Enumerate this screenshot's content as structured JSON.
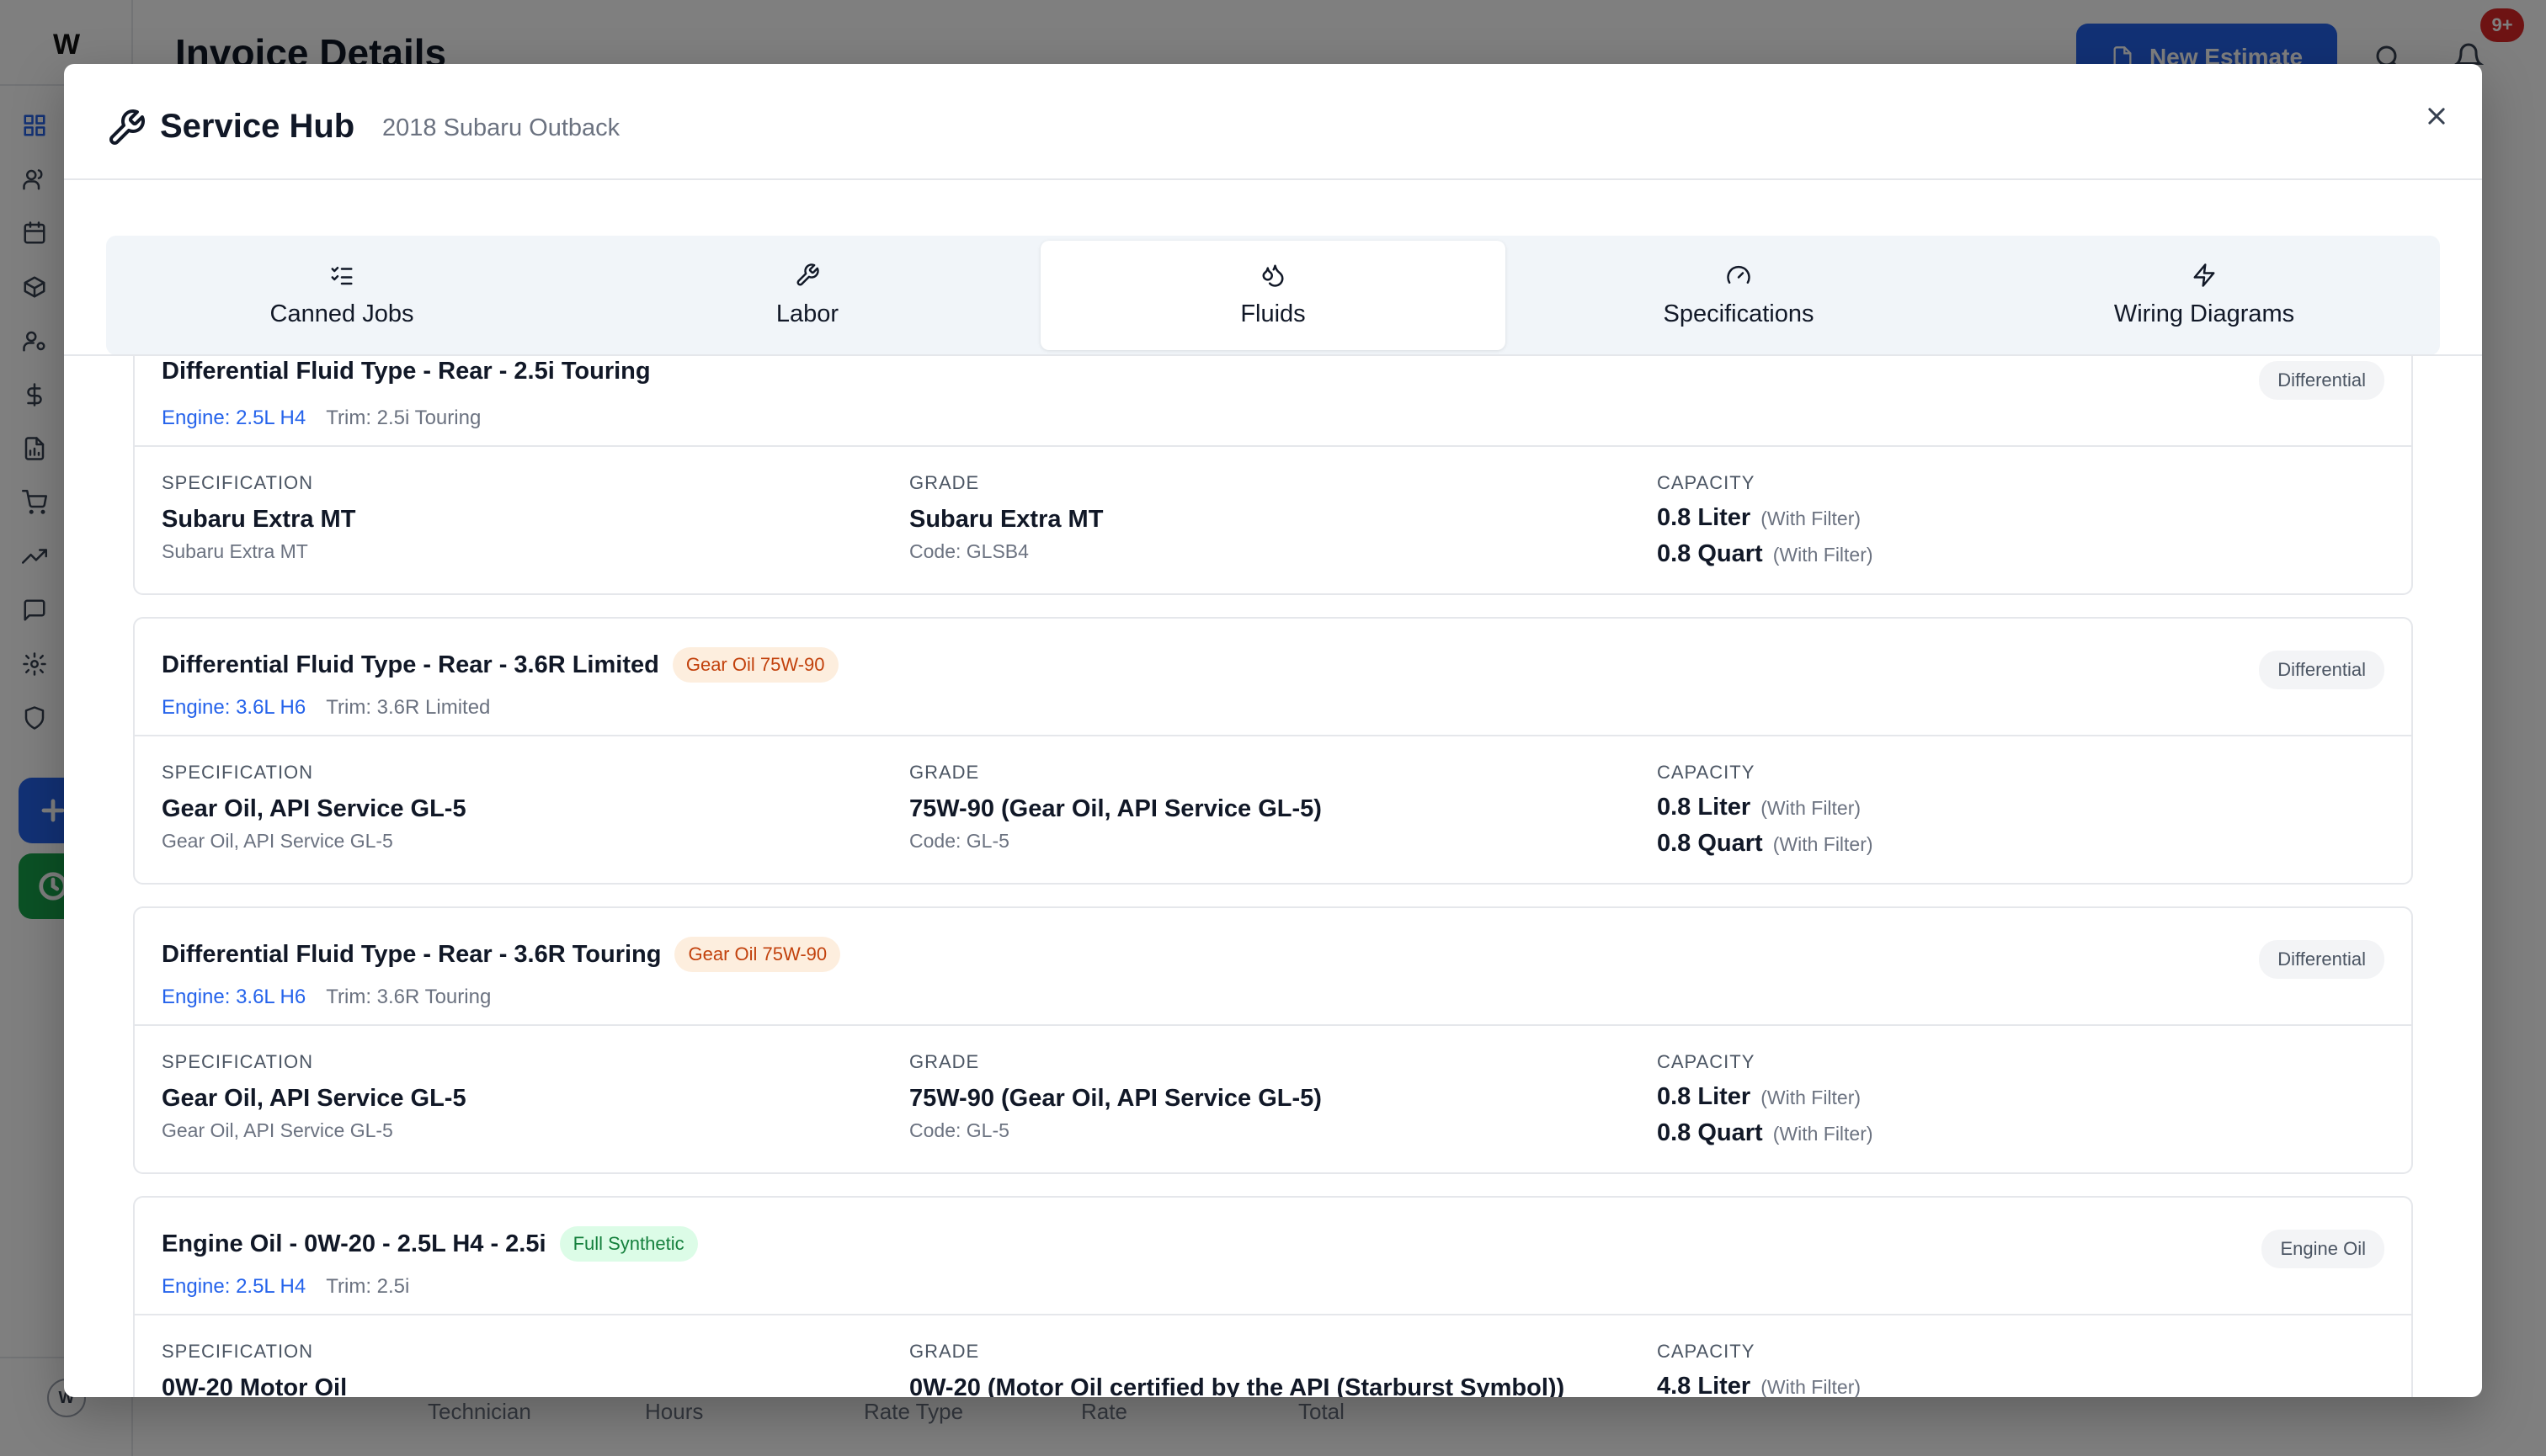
{
  "app": {
    "brand": "W",
    "page_title": "Invoice Details",
    "new_estimate_label": "New Estimate",
    "notification_badge": "9+",
    "user_initial": "W",
    "bg_table_headers": [
      "Technician",
      "Hours",
      "Rate Type",
      "Rate",
      "Total"
    ]
  },
  "modal": {
    "title": "Service Hub",
    "vehicle": "2018 Subaru Outback",
    "tabs": [
      {
        "label": "Canned Jobs",
        "icon": "list-check-icon"
      },
      {
        "label": "Labor",
        "icon": "wrench-icon"
      },
      {
        "label": "Fluids",
        "icon": "droplets-icon",
        "active": true
      },
      {
        "label": "Specifications",
        "icon": "gauge-icon"
      },
      {
        "label": "Wiring Diagrams",
        "icon": "zap-icon"
      }
    ],
    "column_headers": {
      "spec": "SPECIFICATION",
      "grade": "GRADE",
      "capacity": "CAPACITY"
    },
    "cards": [
      {
        "title": "Differential Fluid Type - Rear - 2.5i Touring",
        "tag": "",
        "engine": "Engine: 2.5L H4",
        "trim": "Trim: 2.5i Touring",
        "category": "Differential",
        "spec_main": "Subaru Extra MT",
        "spec_sub": "Subaru Extra MT",
        "grade_main": "Subaru Extra MT",
        "grade_sub": "Code: GLSB4",
        "cap1": "0.8 Liter",
        "cap1_note": "(With Filter)",
        "cap2": "0.8 Quart",
        "cap2_note": "(With Filter)"
      },
      {
        "title": "Differential Fluid Type - Rear - 3.6R Limited",
        "tag": "Gear Oil 75W-90",
        "engine": "Engine: 3.6L H6",
        "trim": "Trim: 3.6R Limited",
        "category": "Differential",
        "spec_main": "Gear Oil, API Service GL-5",
        "spec_sub": "Gear Oil, API Service GL-5",
        "grade_main": "75W-90 (Gear Oil, API Service GL-5)",
        "grade_sub": "Code: GL-5",
        "cap1": "0.8 Liter",
        "cap1_note": "(With Filter)",
        "cap2": "0.8 Quart",
        "cap2_note": "(With Filter)"
      },
      {
        "title": "Differential Fluid Type - Rear - 3.6R Touring",
        "tag": "Gear Oil 75W-90",
        "engine": "Engine: 3.6L H6",
        "trim": "Trim: 3.6R Touring",
        "category": "Differential",
        "spec_main": "Gear Oil, API Service GL-5",
        "spec_sub": "Gear Oil, API Service GL-5",
        "grade_main": "75W-90 (Gear Oil, API Service GL-5)",
        "grade_sub": "Code: GL-5",
        "cap1": "0.8 Liter",
        "cap1_note": "(With Filter)",
        "cap2": "0.8 Quart",
        "cap2_note": "(With Filter)"
      },
      {
        "title": "Engine Oil - 0W-20 - 2.5L H4 - 2.5i",
        "tag": "Full Synthetic",
        "engine": "Engine: 2.5L H4",
        "trim": "Trim: 2.5i",
        "category": "Engine Oil",
        "spec_main": "0W-20 Motor Oil",
        "spec_sub": "",
        "grade_main": "0W-20 (Motor Oil certified by the API (Starburst Symbol))",
        "grade_sub": "",
        "cap1": "4.8 Liter",
        "cap1_note": "(With Filter)",
        "cap2": "",
        "cap2_note": ""
      }
    ]
  },
  "colors": {
    "accent": "#2563eb",
    "success": "#16a34a",
    "badge": "#dc2626",
    "tag_orange": "#c2410c",
    "tag_green": "#15803d"
  }
}
